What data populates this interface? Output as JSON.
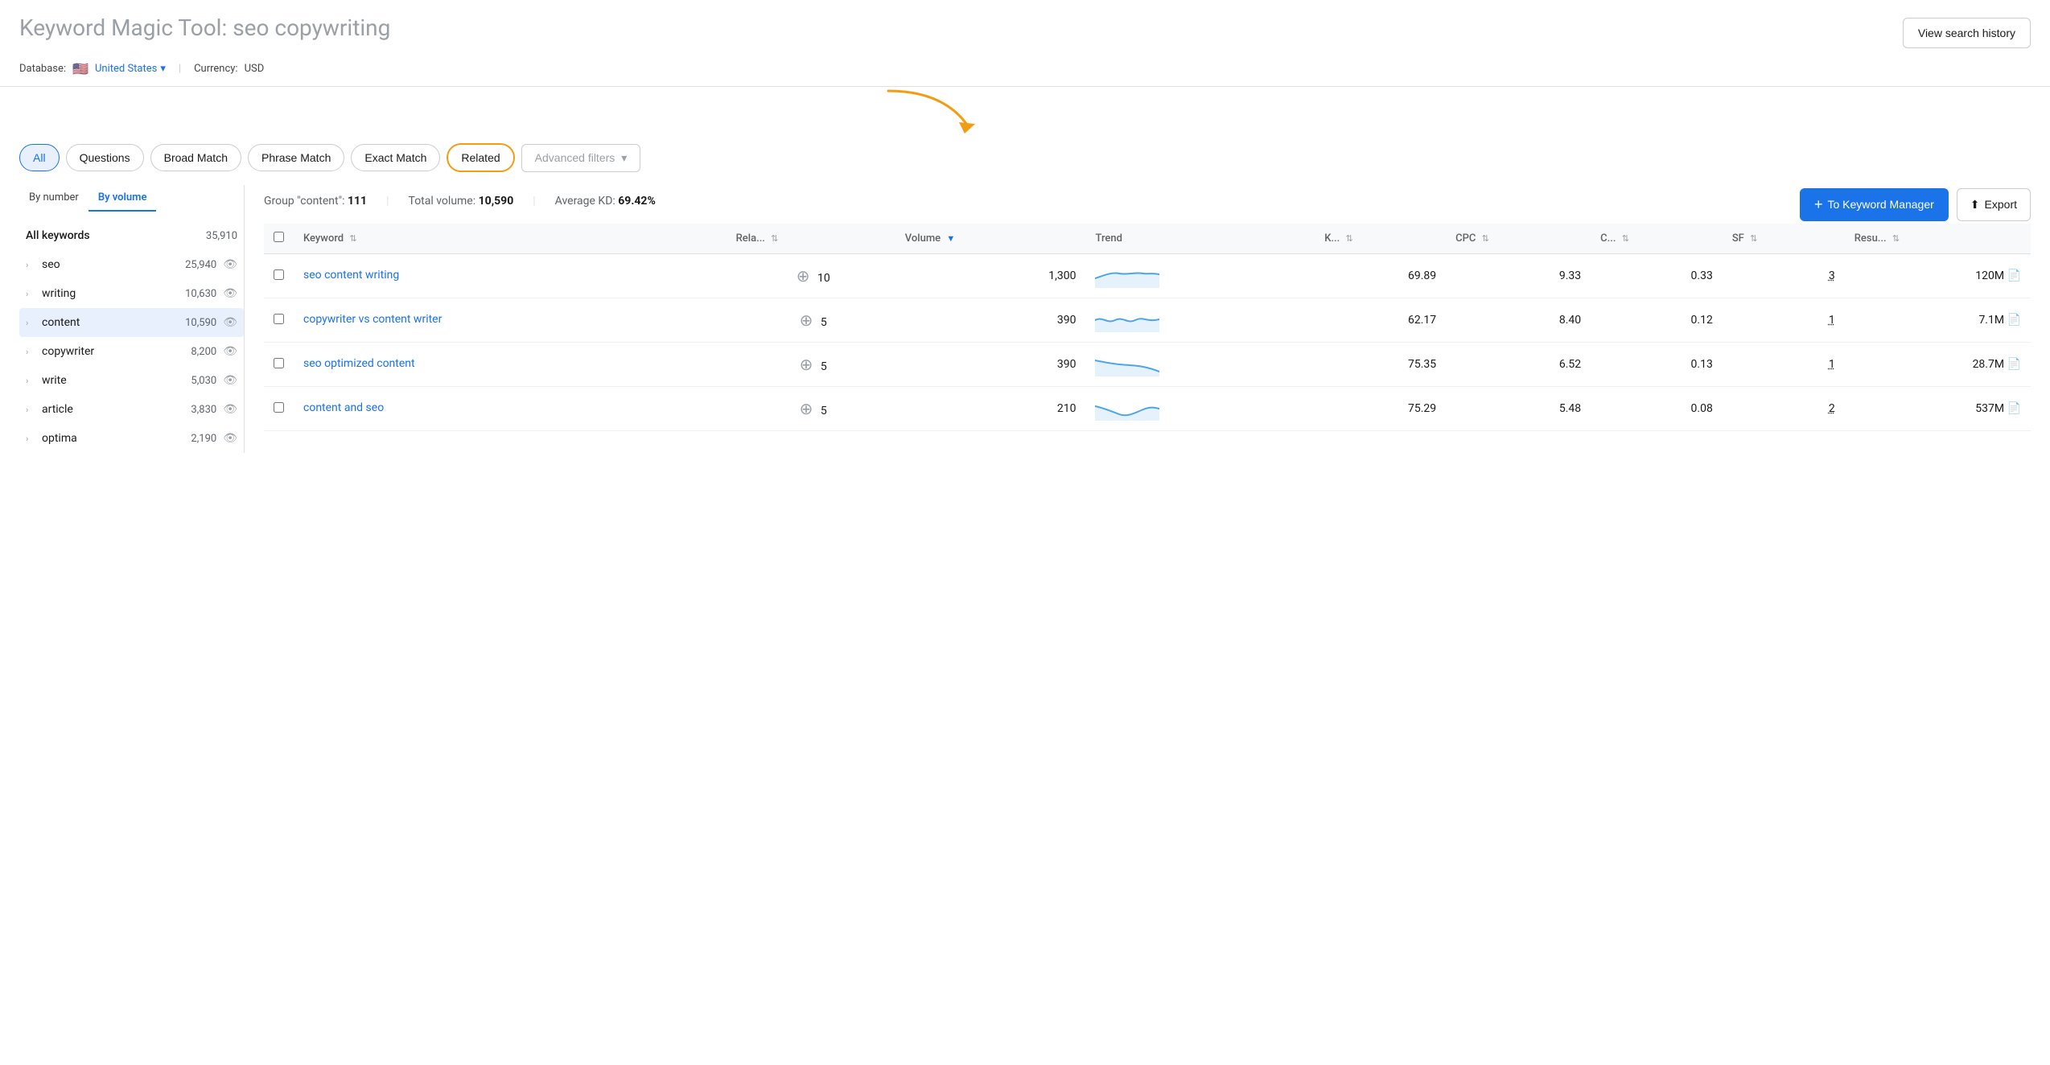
{
  "header": {
    "title_prefix": "Keyword Magic Tool: ",
    "title_query": "seo copywriting",
    "view_history_label": "View search history"
  },
  "subheader": {
    "database_label": "Database:",
    "country": "United States",
    "currency_label": "Currency:",
    "currency": "USD"
  },
  "filters": {
    "all_label": "All",
    "questions_label": "Questions",
    "broad_match_label": "Broad Match",
    "phrase_match_label": "Phrase Match",
    "exact_match_label": "Exact Match",
    "related_label": "Related",
    "advanced_filters_label": "Advanced filters"
  },
  "sidebar": {
    "tab_by_number": "By number",
    "tab_by_volume": "By volume",
    "all_keywords_label": "All keywords",
    "all_keywords_count": "35,910",
    "items": [
      {
        "label": "seo",
        "count": "25,940"
      },
      {
        "label": "writing",
        "count": "10,630"
      },
      {
        "label": "content",
        "count": "10,590",
        "selected": true
      },
      {
        "label": "copywriter",
        "count": "8,200"
      },
      {
        "label": "write",
        "count": "5,030"
      },
      {
        "label": "article",
        "count": "3,830"
      },
      {
        "label": "optima",
        "count": "2,190"
      }
    ]
  },
  "stats": {
    "group_label": "Group \"content\":",
    "group_value": "111",
    "total_volume_label": "Total volume:",
    "total_volume_value": "10,590",
    "avg_kd_label": "Average KD:",
    "avg_kd_value": "69.42%"
  },
  "actions": {
    "to_km_label": "To Keyword Manager",
    "export_label": "Export"
  },
  "table": {
    "columns": [
      {
        "key": "keyword",
        "label": "Keyword"
      },
      {
        "key": "related",
        "label": "Rela..."
      },
      {
        "key": "volume",
        "label": "Volume"
      },
      {
        "key": "trend",
        "label": "Trend"
      },
      {
        "key": "kd",
        "label": "K..."
      },
      {
        "key": "cpc",
        "label": "CPC"
      },
      {
        "key": "com",
        "label": "C..."
      },
      {
        "key": "sf",
        "label": "SF"
      },
      {
        "key": "results",
        "label": "Resu..."
      }
    ],
    "rows": [
      {
        "keyword": "seo content writing",
        "related": "10",
        "volume": "1,300",
        "trend": "stable_high",
        "kd": "69.89",
        "cpc": "9.33",
        "com": "0.33",
        "sf": "3",
        "results": "120M"
      },
      {
        "keyword": "copywriter vs content writer",
        "related": "5",
        "volume": "390",
        "trend": "wavy",
        "kd": "62.17",
        "cpc": "8.40",
        "com": "0.12",
        "sf": "1",
        "results": "7.1M"
      },
      {
        "keyword": "seo optimized content",
        "related": "5",
        "volume": "390",
        "trend": "declining",
        "kd": "75.35",
        "cpc": "6.52",
        "com": "0.13",
        "sf": "1",
        "results": "28.7M"
      },
      {
        "keyword": "content and seo",
        "related": "5",
        "volume": "210",
        "trend": "dip",
        "kd": "75.29",
        "cpc": "5.48",
        "com": "0.08",
        "sf": "2",
        "results": "537M"
      }
    ]
  },
  "colors": {
    "primary": "#1a73e8",
    "related_border": "#f39c12",
    "active_bg": "#e8f0fe",
    "selected_sidebar": "#e8f0fe",
    "trend_line": "#4da6e8",
    "trend_fill": "#d6eaf8"
  }
}
